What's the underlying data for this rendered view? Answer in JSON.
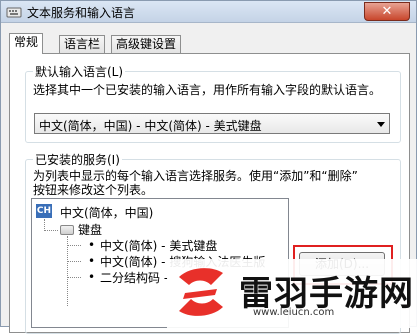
{
  "window": {
    "title": "文本服务和输入语言",
    "close_label": "✕"
  },
  "tabs": [
    {
      "label": "常规"
    },
    {
      "label": "语言栏"
    },
    {
      "label": "高级键设置"
    }
  ],
  "default_input": {
    "group_label": "默认输入语言(L)",
    "description": "选择其中一个已安装的输入语言，用作所有输入字段的默认语言。",
    "selected": "中文(简体，中国) - 中文(简体) - 美式键盘"
  },
  "installed_services": {
    "group_label": "已安装的服务(I)",
    "description_line1": "为列表中显示的每个输入语言选择服务。使用“添加”和“删除”",
    "description_line2": "按钮来修改这个列表。",
    "tree": {
      "badge": "CH",
      "language": "中文(简体，中国)",
      "keyboard_node": "键盘",
      "items": [
        "中文(简体) - 美式键盘",
        "中文(简体) - 搜狗输入法医生版",
        "二分结构码 -"
      ]
    },
    "add_button": "添加(D)..."
  },
  "watermark": {
    "name": "雷羽手游网",
    "url": "www.leiucn.com"
  },
  "colors": {
    "badge": "#3a6fb8",
    "highlight": "#e02020",
    "watermark_red": "#e8302a"
  }
}
